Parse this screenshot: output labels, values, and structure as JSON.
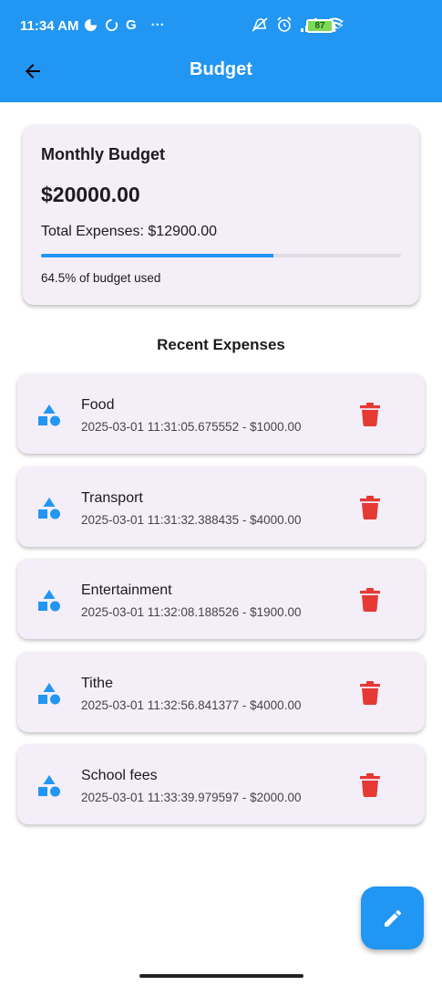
{
  "status_bar": {
    "time": "11:34 AM",
    "g_label": "G",
    "dots": "···",
    "battery": "87"
  },
  "app_bar": {
    "title": "Budget",
    "color": "#2196f3"
  },
  "budget_card": {
    "title": "Monthly Budget",
    "amount": "$20000.00",
    "total_expenses": "Total Expenses: $12900.00",
    "usage_fraction": 0.645,
    "usage_text": "64.5% of budget used"
  },
  "recent_expenses": {
    "title": "Recent Expenses",
    "items": [
      {
        "name": "Food",
        "detail": "2025-03-01 11:31:05.675552 - $1000.00"
      },
      {
        "name": "Transport",
        "detail": "2025-03-01 11:31:32.388435 - $4000.00"
      },
      {
        "name": "Entertainment",
        "detail": "2025-03-01 11:32:08.188526 - $1900.00"
      },
      {
        "name": "Tithe",
        "detail": "2025-03-01 11:32:56.841377 - $4000.00"
      },
      {
        "name": "School fees",
        "detail": "2025-03-01 11:33:39.979597 - $2000.00"
      }
    ]
  },
  "icons": {
    "back": "arrow-back-icon",
    "category": "category-shapes-icon",
    "delete": "trash-icon",
    "fab": "pencil-edit-icon"
  },
  "colors": {
    "primary": "#2196f3",
    "delete": "#e53935",
    "card_bg": "#f3eef8"
  }
}
